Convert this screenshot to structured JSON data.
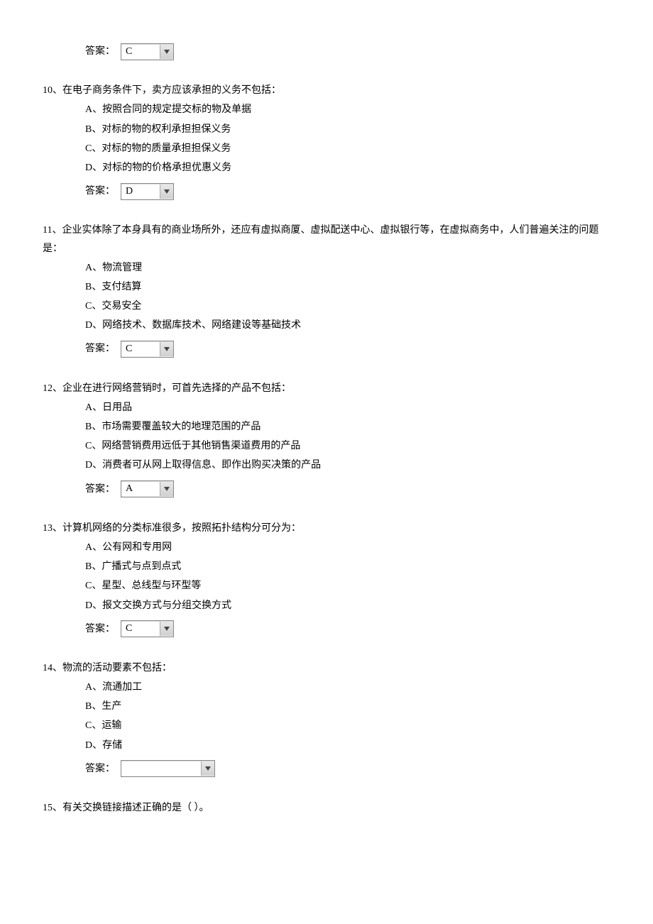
{
  "answer_label": "答案：",
  "q9": {
    "answer": "C"
  },
  "q10": {
    "stem": "10、在电子商务条件下，卖方应该承担的义务不包括：",
    "a": "A、按照合同的规定提交标的物及单据",
    "b": "B、对标的物的权利承担担保义务",
    "c": "C、对标的物的质量承担担保义务",
    "d": "D、对标的物的价格承担优惠义务",
    "answer": "D"
  },
  "q11": {
    "stem": "11、企业实体除了本身具有的商业场所外，还应有虚拟商厦、虚拟配送中心、虚拟银行等，在虚拟商务中，人们普遍关注的问题是：",
    "a": "A、物流管理",
    "b": "B、支付结算",
    "c": "C、交易安全",
    "d": "D、网络技术、数据库技术、网络建设等基础技术",
    "answer": "C"
  },
  "q12": {
    "stem": "12、企业在进行网络营销时，可首先选择的产品不包括：",
    "a": "A、日用品",
    "b": "B、市场需要覆盖较大的地理范围的产品",
    "c": "C、网络营销费用远低于其他销售渠道费用的产品",
    "d": "D、消费者可从网上取得信息、即作出购买决策的产品",
    "answer": "A"
  },
  "q13": {
    "stem": "13、计算机网络的分类标准很多，按照拓扑结构分可分为：",
    "a": "A、公有网和专用网",
    "b": "B、广播式与点到点式",
    "c": "C、星型、总线型与环型等",
    "d": "D、报文交换方式与分组交换方式",
    "answer": "C"
  },
  "q14": {
    "stem": "14、物流的活动要素不包括：",
    "a": "A、流通加工",
    "b": "B、生产",
    "c": "C、运输",
    "d": "D、存储",
    "answer": ""
  },
  "q15": {
    "stem": "15、有关交换链接描述正确的是（  ）。"
  }
}
